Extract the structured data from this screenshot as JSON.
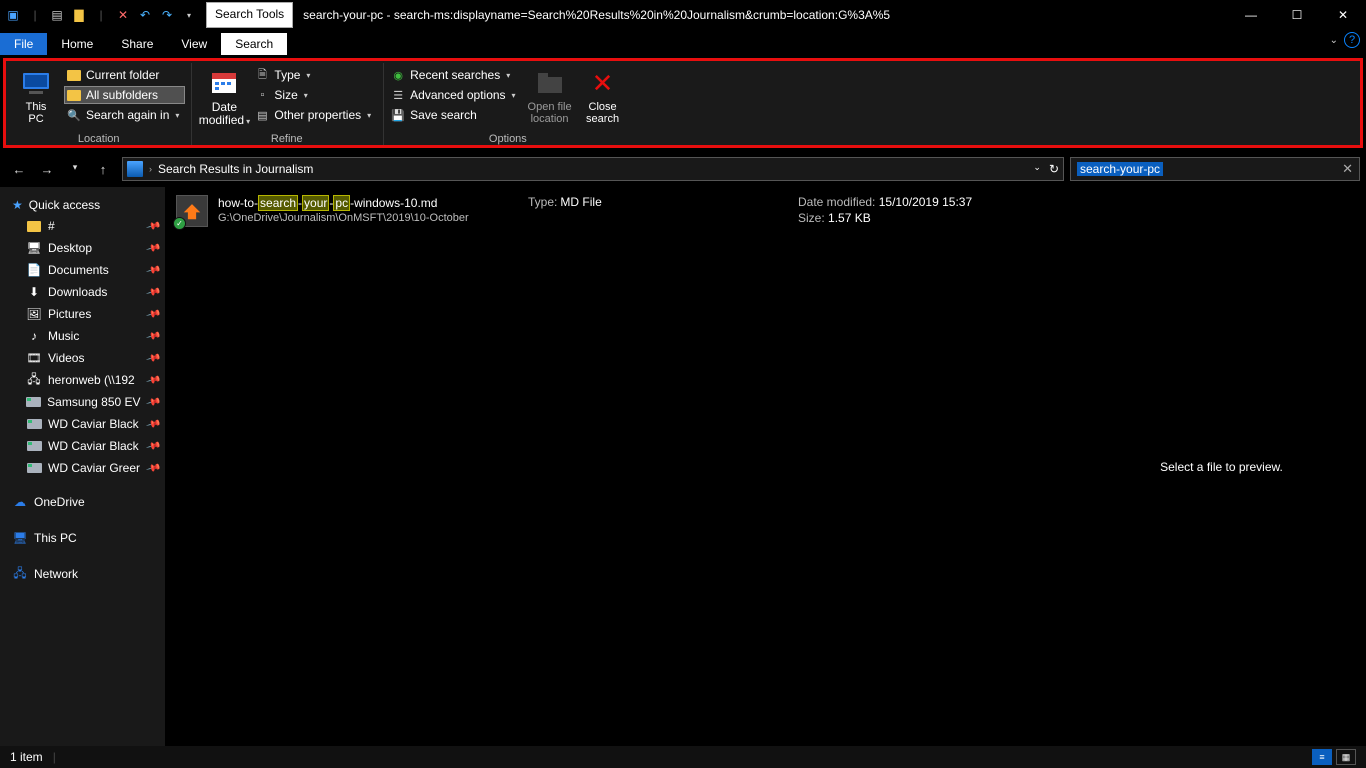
{
  "window": {
    "title": "search-your-pc - search-ms:displayname=Search%20Results%20in%20Journalism&crumb=location:G%3A%5",
    "search_tools_label": "Search Tools"
  },
  "menubar": {
    "file": "File",
    "home": "Home",
    "share": "Share",
    "view": "View",
    "search": "Search"
  },
  "ribbon": {
    "location": {
      "label": "Location",
      "this_pc": "This\nPC",
      "current_folder": "Current folder",
      "all_subfolders": "All subfolders",
      "search_again": "Search again in"
    },
    "refine": {
      "label": "Refine",
      "date_modified": "Date\nmodified",
      "type": "Type",
      "size": "Size",
      "other_properties": "Other properties"
    },
    "options": {
      "label": "Options",
      "recent_searches": "Recent searches",
      "advanced_options": "Advanced options",
      "save_search": "Save search",
      "open_file_location": "Open file\nlocation",
      "close_search": "Close\nsearch"
    }
  },
  "address": {
    "path_text": "Search Results in Journalism"
  },
  "search_box": {
    "query": "search-your-pc"
  },
  "sidebar": {
    "quick_access": "Quick access",
    "items": [
      {
        "label": "#"
      },
      {
        "label": "Desktop"
      },
      {
        "label": "Documents"
      },
      {
        "label": "Downloads"
      },
      {
        "label": "Pictures"
      },
      {
        "label": "Music"
      },
      {
        "label": "Videos"
      },
      {
        "label": "heronweb (\\\\192"
      },
      {
        "label": "Samsung 850 EV"
      },
      {
        "label": "WD Caviar Black"
      },
      {
        "label": "WD Caviar Black"
      },
      {
        "label": "WD Caviar Greer"
      }
    ],
    "onedrive": "OneDrive",
    "this_pc": "This PC",
    "network": "Network"
  },
  "results": {
    "file": {
      "name_parts": [
        "how-to-",
        "search",
        "-",
        "your",
        "-",
        "pc",
        "-windows-10.md"
      ],
      "path": "G:\\OneDrive\\Journalism\\OnMSFT\\2019\\10-October",
      "type_label": "Type:",
      "type_value": "MD File",
      "date_label": "Date modified:",
      "date_value": "15/10/2019 15:37",
      "size_label": "Size:",
      "size_value": "1.57 KB"
    }
  },
  "preview": {
    "placeholder": "Select a file to preview."
  },
  "status": {
    "count": "1 item"
  }
}
